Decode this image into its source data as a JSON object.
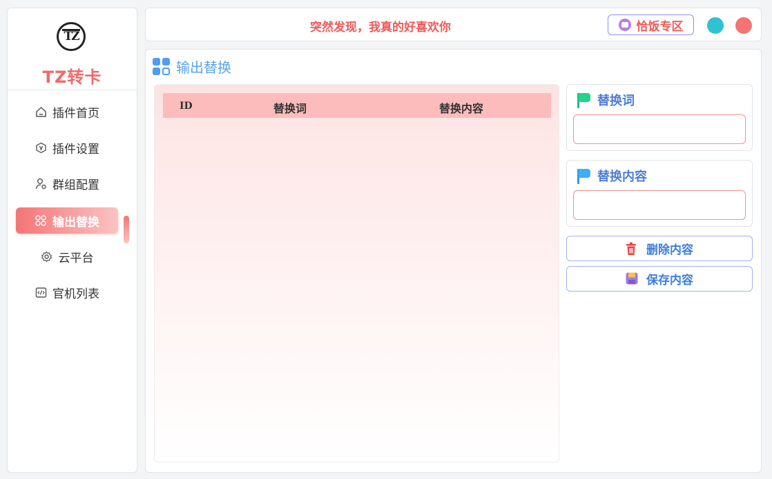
{
  "sidebar": {
    "logo_mark": "TZ",
    "brand": "TZ转卡",
    "items": [
      {
        "label": "插件首页",
        "icon": "home-icon",
        "active": false
      },
      {
        "label": "插件设置",
        "icon": "settings-hexagon-icon",
        "active": false
      },
      {
        "label": "群组配置",
        "icon": "user-settings-icon",
        "active": false
      },
      {
        "label": "输出替换",
        "icon": "grid-icon",
        "active": true
      },
      {
        "label": "云平台",
        "icon": "gear-icon",
        "active": false
      },
      {
        "label": "官机列表",
        "icon": "code-icon",
        "active": false
      }
    ]
  },
  "header": {
    "slogan": "突然发现，我真的好喜欢你",
    "ad_button": "恰饭专区",
    "ad_icon": "ad-badge-icon"
  },
  "main": {
    "title": "输出替换",
    "title_icon": "grid-icon",
    "table": {
      "columns": [
        "ID",
        "替换词",
        "替换内容"
      ],
      "rows": []
    },
    "form": {
      "word_label": "替换词",
      "word_value": "",
      "content_label": "替换内容",
      "content_value": "",
      "delete_button": "删除内容",
      "save_button": "保存内容"
    }
  },
  "colors": {
    "accent_red": "#f15a5a",
    "accent_blue": "#4d7cd8",
    "window_dot_cyan": "#2fc2d1",
    "window_dot_red": "#f27474"
  }
}
